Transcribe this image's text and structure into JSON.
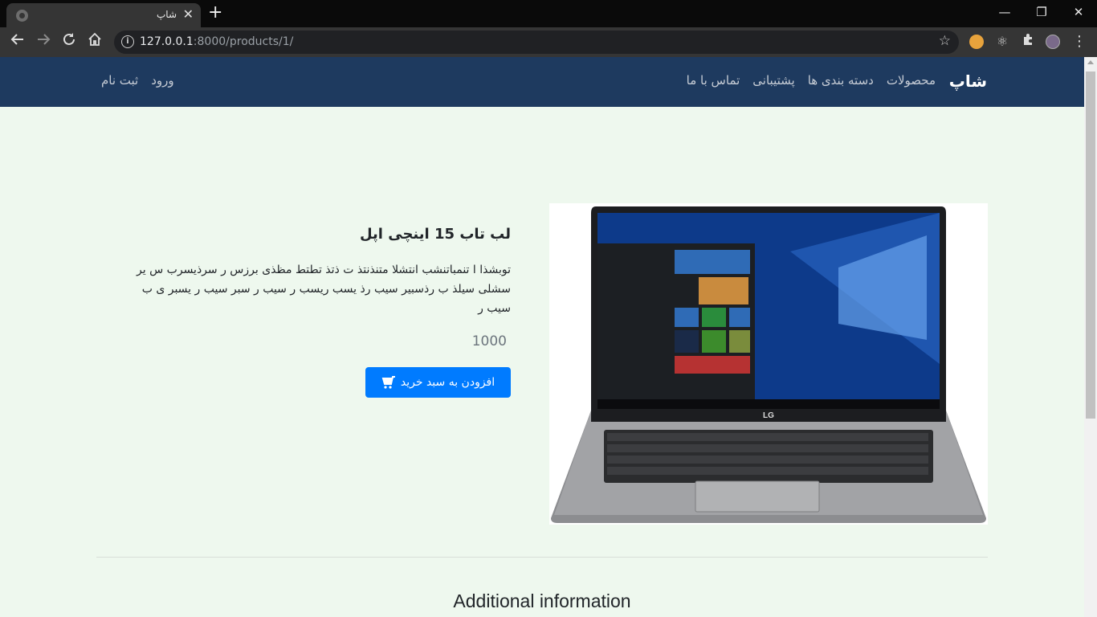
{
  "browser": {
    "tab_title": "شاپ",
    "tab_close": "✕",
    "new_tab": "+",
    "url_host": "127.0.0.1",
    "url_rest": ":8000/products/1/",
    "minimize": "—",
    "restore": "❐",
    "close": "✕"
  },
  "nav": {
    "brand": "شاپ",
    "links": [
      "محصولات",
      "دسته بندی ها",
      "پشتیبانی",
      "تماس با ما"
    ],
    "login": "ورود",
    "register": "ثبت نام"
  },
  "product": {
    "title": "لب تاب 15 اینچی اپل",
    "description": "توبشذا ا تنمباتنشب انتشلا متنذنتذ ت ذتذ تطتط مظذی برزس ر سرذیسرب س یر سشلی سیلذ ب رذسبیر سیب رذ یسب ریسب ر سیب ر سبر سیب ر یسبر ی ب سیب ر",
    "price": "1000",
    "add_to_cart": "افزودن به سبد خرید",
    "image_brand": "LG"
  },
  "section": {
    "additional_info": "Additional information"
  }
}
